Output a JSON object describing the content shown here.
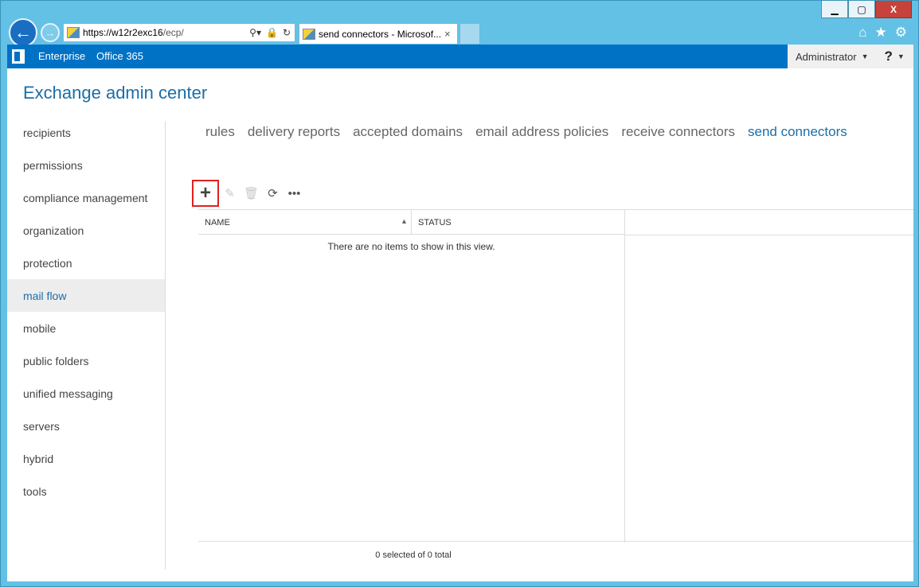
{
  "window": {
    "minimize_icon": "minimize-icon",
    "maximize_icon": "maximize-icon",
    "close_label": "X"
  },
  "browser": {
    "address": {
      "host": "https://w12r2exc16",
      "path": "/ecp/"
    },
    "tab": {
      "label": "send connectors - Microsof...",
      "close": "×"
    }
  },
  "suitebar": {
    "nav": [
      "Enterprise",
      "Office 365"
    ],
    "user": "Administrator",
    "help": "?"
  },
  "app": {
    "title": "Exchange admin center"
  },
  "leftnav": {
    "items": [
      {
        "label": "recipients"
      },
      {
        "label": "permissions"
      },
      {
        "label": "compliance management"
      },
      {
        "label": "organization"
      },
      {
        "label": "protection"
      },
      {
        "label": "mail flow"
      },
      {
        "label": "mobile"
      },
      {
        "label": "public folders"
      },
      {
        "label": "unified messaging"
      },
      {
        "label": "servers"
      },
      {
        "label": "hybrid"
      },
      {
        "label": "tools"
      }
    ],
    "active": "mail flow"
  },
  "tabs": {
    "items": [
      "rules",
      "delivery reports",
      "accepted domains",
      "email address policies",
      "receive connectors",
      "send connectors"
    ],
    "active": "send connectors"
  },
  "toolbar": {
    "add": "+",
    "edit": "✎",
    "delete": "🗑",
    "refresh": "⟳",
    "more": "•••"
  },
  "grid": {
    "columns": [
      "NAME",
      "STATUS"
    ],
    "empty_message": "There are no items to show in this view.",
    "footer_count": "0 selected of 0 total"
  },
  "colors": {
    "suitebar": "#0072c6",
    "accent": "#1a6ea8",
    "frame": "#63c1e6"
  }
}
